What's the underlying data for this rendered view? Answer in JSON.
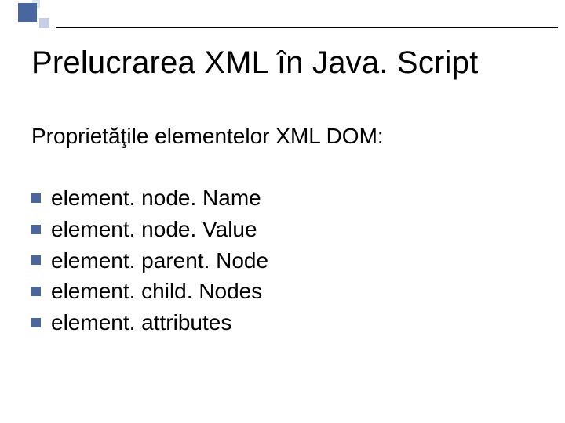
{
  "slide": {
    "title": "Prelucrarea XML în Java. Script",
    "subtitle": "Proprietăţile elementelor XML DOM:",
    "items": [
      "element. node. Name",
      "element. node. Value",
      "element. parent. Node",
      "element. child. Nodes",
      "element. attributes"
    ]
  },
  "theme": {
    "accent": "#4a66a0",
    "accent_light": "#c5cee4",
    "accent_lighter": "#dde3ef"
  }
}
